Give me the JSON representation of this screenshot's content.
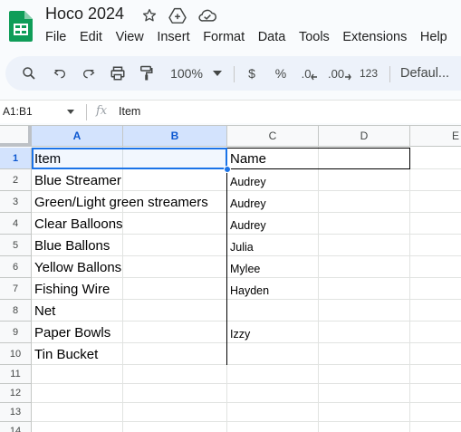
{
  "app": {
    "doc_title": "Hoco 2024",
    "menus": [
      "File",
      "Edit",
      "View",
      "Insert",
      "Format",
      "Data",
      "Tools",
      "Extensions",
      "Help"
    ],
    "title_icons": [
      "star-icon",
      "move-to-drive-icon",
      "cloud-status-icon"
    ]
  },
  "toolbar": {
    "zoom": "100%",
    "currency": "$",
    "percent": "%",
    "decrease_decimal": ".0",
    "increase_decimal": ".00",
    "number_format": "123",
    "font": "Defaul..."
  },
  "formula_bar": {
    "name_box": "A1:B1",
    "fx": "fx",
    "value": "Item"
  },
  "sheet": {
    "columns": [
      "A",
      "B",
      "C",
      "D",
      "E"
    ],
    "row_numbers": [
      "1",
      "2",
      "3",
      "4",
      "5",
      "6",
      "7",
      "8",
      "9",
      "10",
      "11",
      "12",
      "13",
      "14"
    ],
    "rows": [
      {
        "item": "Item",
        "name": "Name"
      },
      {
        "item": "Blue Streamer",
        "name": "Audrey"
      },
      {
        "item": "Green/Light green streamers",
        "name": "Audrey"
      },
      {
        "item": "Clear Balloons",
        "name": "Audrey"
      },
      {
        "item": "Blue Ballons",
        "name": "Julia"
      },
      {
        "item": "Yellow Ballons",
        "name": "Mylee"
      },
      {
        "item": "Fishing Wire",
        "name": "Hayden"
      },
      {
        "item": "Net",
        "name": ""
      },
      {
        "item": "Paper Bowls",
        "name": "Izzy"
      },
      {
        "item": "Tin Bucket",
        "name": ""
      }
    ]
  },
  "colors": {
    "selection": "#1a73e8",
    "header_selected": "#d3e3fd",
    "toolbar_bg": "#edf2fa",
    "sheets_green": "#0f9d58"
  }
}
